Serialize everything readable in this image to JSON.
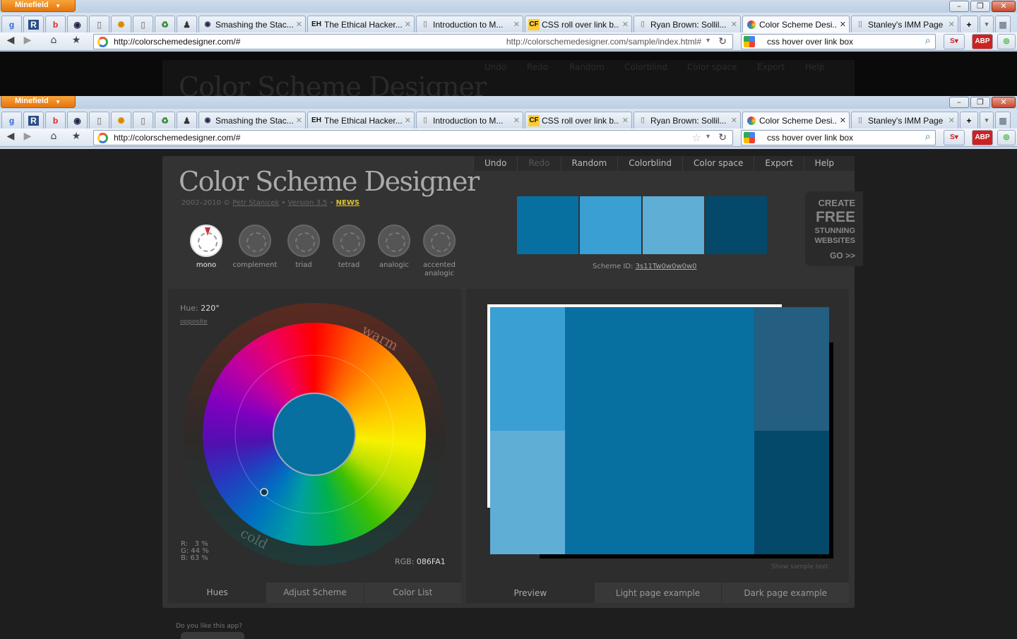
{
  "browser": {
    "app_button": "Minefield",
    "tabs": [
      {
        "label": "Smashing the Stac...",
        "icon": "eye-icon"
      },
      {
        "label": "The Ethical Hacker...",
        "icon": "eh-icon"
      },
      {
        "label": "Introduction to M...",
        "icon": "page-icon"
      },
      {
        "label": "CSS roll over link b...",
        "icon": "cf-icon"
      },
      {
        "label": "Ryan Brown: Sollil...",
        "icon": "page-icon"
      },
      {
        "label": "Color Scheme Desi...",
        "icon": "colorwheel-icon",
        "active": true
      },
      {
        "label": "Stanley's IMM Page",
        "icon": "page-icon"
      }
    ],
    "url": "http://colorschemedesigner.com/#",
    "ghost_url_hint": "http://colorschemedesigner.com/sample/index.html#",
    "search": "css hover over link box"
  },
  "ghost": {
    "title": "Color Scheme Designer",
    "menu": [
      "Undo",
      "Redo",
      "Random",
      "Colorblind",
      "Color space",
      "Export",
      "Help"
    ]
  },
  "app": {
    "title": "Color Scheme Designer",
    "credit": {
      "years": "2002–2010 ©",
      "author": "Petr Stanicek",
      "version": "Version 3.5",
      "news": "NEWS"
    },
    "menu": [
      {
        "label": "Undo",
        "enabled": true
      },
      {
        "label": "Redo",
        "enabled": false
      },
      {
        "label": "Random",
        "enabled": true
      },
      {
        "label": "Colorblind",
        "enabled": true
      },
      {
        "label": "Color space",
        "enabled": true
      },
      {
        "label": "Export",
        "enabled": true
      },
      {
        "label": "Help",
        "enabled": true
      }
    ],
    "scheme_types": [
      {
        "label": "mono",
        "active": true
      },
      {
        "label": "complement"
      },
      {
        "label": "triad"
      },
      {
        "label": "tetrad"
      },
      {
        "label": "analogic"
      },
      {
        "label": "accented analogic"
      }
    ],
    "swatch_colors": [
      "#086FA1",
      "#3A9FD3",
      "#5EAED6",
      "#04496A"
    ],
    "scheme_id_label": "Scheme ID:",
    "scheme_id": "3s11Tw0w0w0w0",
    "promo": {
      "line1": "CREATE",
      "line2": "FREE",
      "line3": "STUNNING",
      "line4": "WEBSITES",
      "go": "GO >>"
    },
    "hue_label": "Hue:",
    "hue_value": "220°",
    "opposite_link": "opposite",
    "wheel_labels": {
      "warm": "warm",
      "cold": "cold"
    },
    "rgb_percent": {
      "r": "R:   3 %",
      "g": "G: 44 %",
      "b": "B: 63 %"
    },
    "rgb_label": "RGB:",
    "rgb_hex": "086FA1",
    "left_tabs": [
      {
        "label": "Hues",
        "active": true
      },
      {
        "label": "Adjust Scheme"
      },
      {
        "label": "Color List"
      }
    ],
    "preview_colors": {
      "main": "#086FA1",
      "light1": "#3A9FD3",
      "light2": "#5EAED6",
      "dark1": "#245E80",
      "dark2": "#04496A"
    },
    "show_sample_text": "Show sample text",
    "right_tabs": [
      {
        "label": "Preview",
        "active": true
      },
      {
        "label": "Light page example"
      },
      {
        "label": "Dark page example"
      }
    ],
    "like_question": "Do you like this app?"
  }
}
